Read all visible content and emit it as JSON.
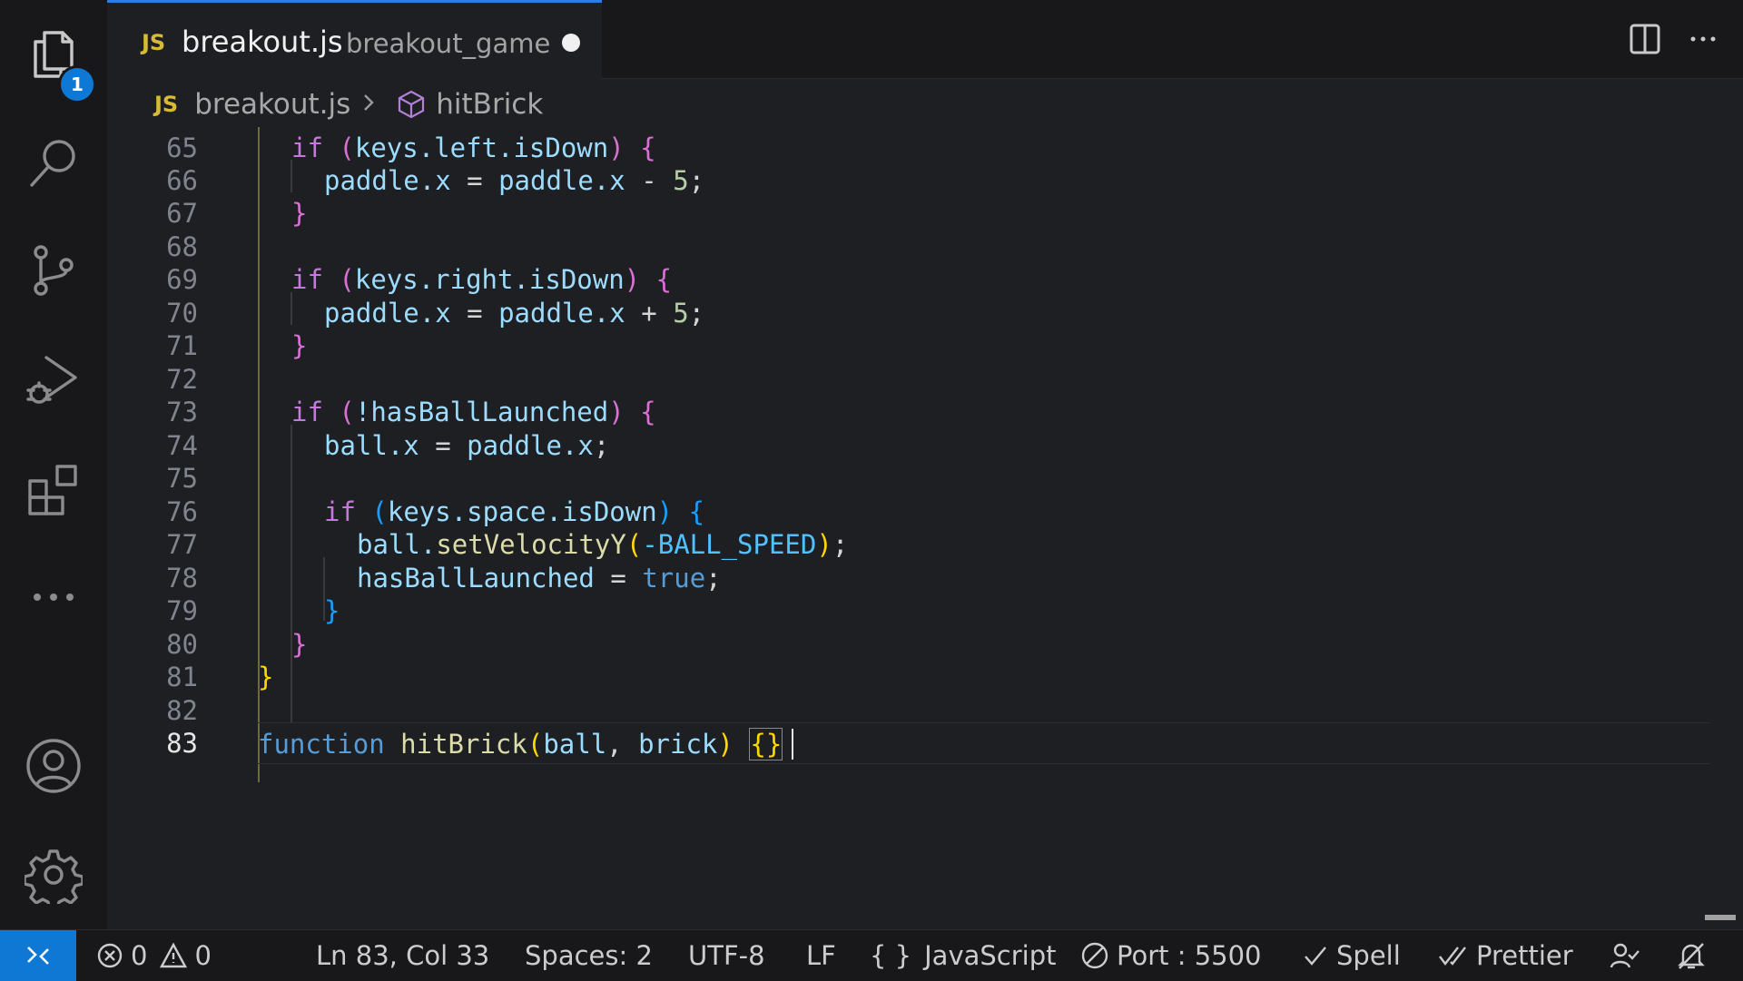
{
  "activity_bar": {
    "explorer_badge": "1"
  },
  "tab": {
    "lang": "JS",
    "filename": "breakout.js",
    "folder": "breakout_game"
  },
  "breadcrumb": {
    "lang": "JS",
    "file": "breakout.js",
    "symbol": "hitBrick"
  },
  "line_numbers": [
    "65",
    "66",
    "67",
    "68",
    "69",
    "70",
    "71",
    "72",
    "73",
    "74",
    "75",
    "76",
    "77",
    "78",
    "79",
    "80",
    "81",
    "82",
    "83"
  ],
  "code": {
    "l65": {
      "kw": "if",
      "p1": "(",
      "expr": "keys.left.isDown",
      "p2": ")",
      "brace": "{"
    },
    "l66": {
      "lhs": "paddle.x",
      "eq": "=",
      "rhs": "paddle.x",
      "op": "-",
      "num": "5",
      "end": ";"
    },
    "l67": {
      "brace": "}"
    },
    "l69": {
      "kw": "if",
      "p1": "(",
      "expr": "keys.right.isDown",
      "p2": ")",
      "brace": "{"
    },
    "l70": {
      "lhs": "paddle.x",
      "eq": "=",
      "rhs": "paddle.x",
      "op": "+",
      "num": "5",
      "end": ";"
    },
    "l71": {
      "brace": "}"
    },
    "l73": {
      "kw": "if",
      "p1": "(",
      "expr": "!hasBallLaunched",
      "p2": ")",
      "brace": "{"
    },
    "l74": {
      "lhs": "ball.x",
      "eq": "=",
      "rhs": "paddle.x",
      "end": ";"
    },
    "l76": {
      "kw": "if",
      "p1": "(",
      "expr": "keys.space.isDown",
      "p2": ")",
      "brace": "{"
    },
    "l77": {
      "obj": "ball.",
      "fn": "setVelocityY",
      "p1": "(",
      "arg": "-BALL_SPEED",
      "p2": ")",
      "end": ";"
    },
    "l78": {
      "lhs": "hasBallLaunched",
      "eq": "=",
      "val": "true",
      "end": ";"
    },
    "l79": {
      "brace": "}"
    },
    "l80": {
      "brace": "}"
    },
    "l81": {
      "brace": "}"
    },
    "l83": {
      "kw": "function",
      "name": "hitBrick",
      "p1": "(",
      "a1": "ball",
      "comma": ",",
      "a2": "brick",
      "p2": ")",
      "b_open": "{",
      "b_close": "}"
    }
  },
  "status": {
    "errors": "0",
    "warnings": "0",
    "position": "Ln 83, Col 33",
    "spaces": "Spaces: 2",
    "encoding": "UTF-8",
    "eol": "LF",
    "language": "JavaScript",
    "port": "Port : 5500",
    "spell": "Spell",
    "prettier": "Prettier"
  },
  "colors": {
    "accent": "#0e78d4",
    "keyword": "#c679dd",
    "function": "#dcdcaa",
    "variable": "#9cdcfe",
    "bracket1": "#ffd700",
    "bracket2": "#da70d6",
    "bracket3": "#179fff"
  },
  "icons": [
    "files-icon",
    "search-icon",
    "source-control-icon",
    "run-debug-icon",
    "extensions-icon",
    "more-icon",
    "account-icon",
    "settings-gear-icon",
    "split-editor-icon",
    "more-actions-icon",
    "symbol-cube-icon",
    "remote-icon",
    "error-icon",
    "warning-icon",
    "braces-icon",
    "port-icon",
    "check-icon",
    "double-check-icon",
    "feedback-icon",
    "bell-slash-icon"
  ]
}
